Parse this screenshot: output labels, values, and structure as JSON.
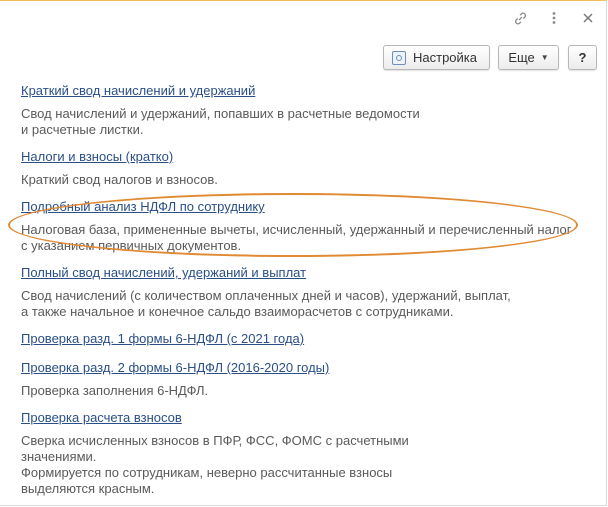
{
  "toolbar": {
    "settings_label": "Настройка",
    "more_label": "Еще",
    "help_label": "?"
  },
  "reports": [
    {
      "title": "Краткий свод начислений и удержаний",
      "description": "Свод начислений и удержаний, попавших в расчетные ведомости\nи расчетные листки."
    },
    {
      "title": "Налоги и взносы (кратко)",
      "description": "Краткий свод налогов и взносов."
    },
    {
      "title": "Подробный анализ НДФЛ по сотруднику",
      "description": "Налоговая база, примененные вычеты, исчисленный, удержанный и перечисленный налог\nс указанием первичных документов."
    },
    {
      "title": "Полный свод начислений, удержаний и выплат",
      "description": "Свод начислений (с количеством оплаченных дней и часов), удержаний, выплат,\nа также начальное и конечное сальдо взаиморасчетов с сотрудниками."
    },
    {
      "title": "Проверка разд. 1 формы 6-НДФЛ (с 2021 года)",
      "description": ""
    },
    {
      "title": "Проверка разд. 2 формы 6-НДФЛ (2016-2020 годы)",
      "description": "Проверка заполнения 6-НДФЛ."
    },
    {
      "title": "Проверка расчета взносов",
      "description": "Сверка исчисленных взносов в ПФР, ФСС, ФОМС с расчетными\nзначениями.\nФормируется по сотрудникам, неверно рассчитанные взносы\nвыделяются красным."
    }
  ],
  "highlight_color": "#e08a34",
  "link_color": "#2a4f86"
}
